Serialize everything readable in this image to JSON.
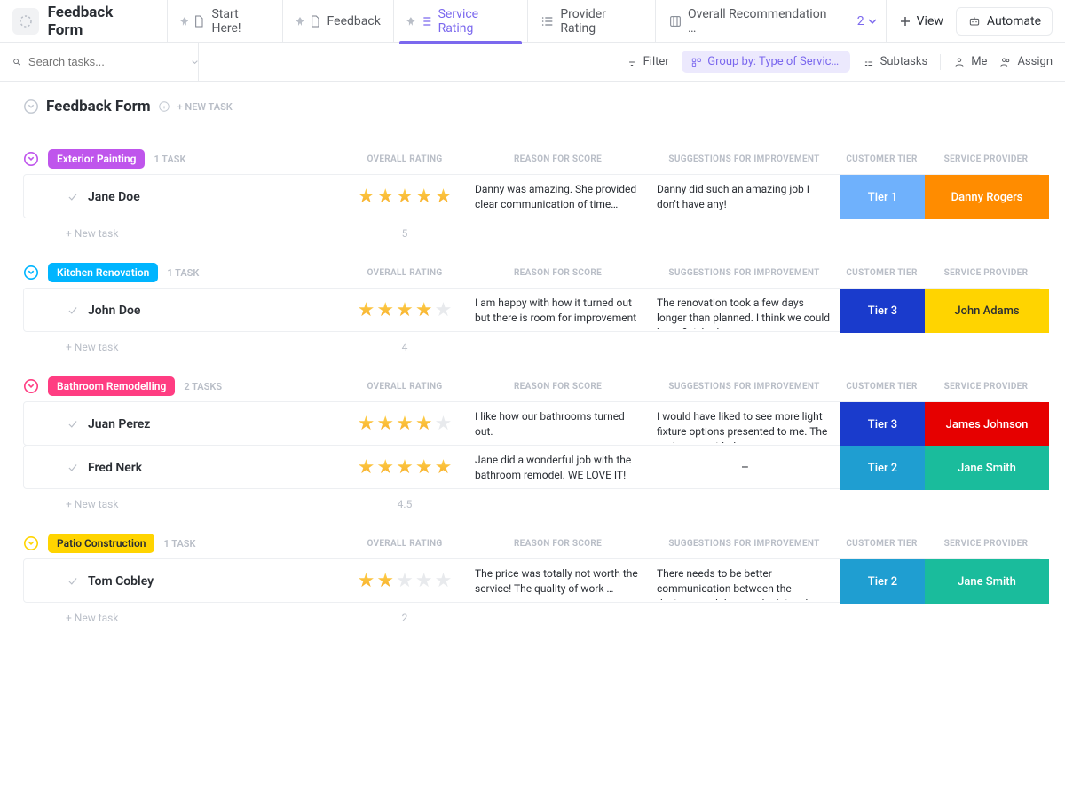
{
  "header": {
    "page_title": "Feedback Form",
    "tabs": [
      {
        "label": "Start Here!",
        "icon": "doc"
      },
      {
        "label": "Feedback",
        "icon": "doc"
      },
      {
        "label": "Service Rating",
        "icon": "list-num",
        "active": true
      },
      {
        "label": "Provider Rating",
        "icon": "list"
      },
      {
        "label": "Overall Recommendation …",
        "icon": "board"
      }
    ],
    "more_count": "2",
    "view_btn": "View",
    "automate_btn": "Automate"
  },
  "toolbar": {
    "search_placeholder": "Search tasks...",
    "filter": "Filter",
    "group_by": "Group by: Type of Service…",
    "subtasks": "Subtasks",
    "me": "Me",
    "assign": "Assign"
  },
  "list": {
    "title": "Feedback Form",
    "new_task": "+ NEW TASK"
  },
  "columns": {
    "overall": "OVERALL RATING",
    "reason": "REASON FOR SCORE",
    "suggest": "SUGGESTIONS FOR IMPROVEMENT",
    "tier": "CUSTOMER TIER",
    "provider": "SERVICE PROVIDER"
  },
  "new_task_row": "+ New task",
  "groups": [
    {
      "name": "Exterior Painting",
      "color": "#bf55ec",
      "chev": "#bf55ec",
      "count": "1 TASK",
      "avg": "5",
      "rows": [
        {
          "name": "Jane Doe",
          "rating": 5,
          "reason": "Danny was amazing. She provided clear communication of time…",
          "suggest": "Danny did such an amazing job I don't have any!",
          "tier": "Tier 1",
          "tier_bg": "#6fb1fc",
          "provider": "Danny Rogers",
          "prov_bg": "#ff8c00",
          "prov_fg": "#fff"
        }
      ]
    },
    {
      "name": "Kitchen Renovation",
      "color": "#00b5ff",
      "chev": "#00b5ff",
      "count": "1 TASK",
      "avg": "4",
      "rows": [
        {
          "name": "John Doe",
          "rating": 4,
          "reason": "I am happy with how it turned out but there is room for improvement",
          "suggest": "The renovation took a few days longer than planned. I think we could have finished on …",
          "tier": "Tier 3",
          "tier_bg": "#1a3bcc",
          "provider": "John Adams",
          "prov_bg": "#ffd400",
          "prov_fg": "#2a2e34"
        }
      ]
    },
    {
      "name": "Bathroom Remodelling",
      "color": "#ff3d82",
      "chev": "#ff3d82",
      "count": "2 TASKS",
      "avg": "4.5",
      "rows": [
        {
          "name": "Juan Perez",
          "rating": 4,
          "reason": "I like how our bathrooms turned out.",
          "suggest": "I would have liked to see more light fixture options presented to me. The options provided…",
          "tier": "Tier 3",
          "tier_bg": "#1a3bcc",
          "provider": "James Johnson",
          "prov_bg": "#e60000",
          "prov_fg": "#fff"
        },
        {
          "name": "Fred Nerk",
          "rating": 5,
          "reason": "Jane did a wonderful job with the bathroom remodel. WE LOVE IT!",
          "suggest": "–",
          "tier": "Tier 2",
          "tier_bg": "#1f9ed1",
          "provider": "Jane Smith",
          "prov_bg": "#1abc9c",
          "prov_fg": "#fff"
        }
      ]
    },
    {
      "name": "Patio Construction",
      "color": "#ffd400",
      "chev": "#ffd400",
      "count": "1 TASK",
      "avg": "2",
      "text_color": "#2a2e34",
      "rows": [
        {
          "name": "Tom Cobley",
          "rating": 2,
          "reason": "The price was totally not worth the service! The quality of work …",
          "suggest": "There needs to be better communication between the designer and the people doing the…",
          "tier": "Tier 2",
          "tier_bg": "#1f9ed1",
          "provider": "Jane Smith",
          "prov_bg": "#1abc9c",
          "prov_fg": "#fff"
        }
      ]
    }
  ]
}
